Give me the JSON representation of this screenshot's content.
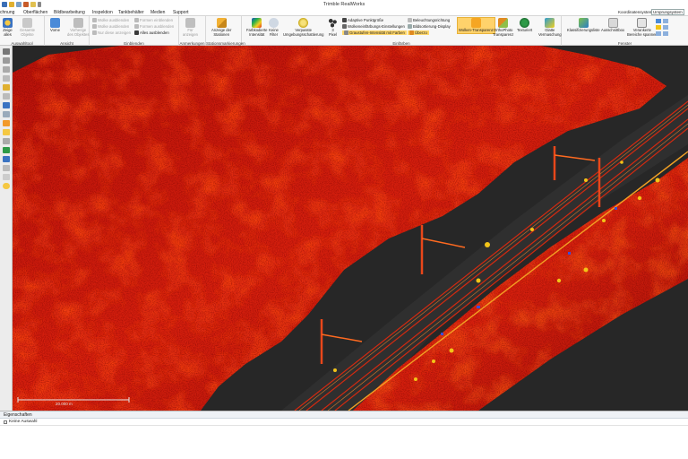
{
  "window": {
    "title": "Trimble RealWorks"
  },
  "menu": {
    "tabs": [
      "chnung",
      "Oberflächen",
      "Bildbearbeitung",
      "Inspektion",
      "Tankbehälter",
      "Medien",
      "Support"
    ],
    "coordinate_label": "Koordinatensystem",
    "coordinate_value": "Ursprungsystem"
  },
  "ribbon": {
    "groups": {
      "auswahl": {
        "label": "Auswahltool",
        "zeige": "Zeige\nalles",
        "gesamte": "Gesamte\nObjekte"
      },
      "ansicht": {
        "label": "Ansicht",
        "vorne": "Vorne",
        "vorherige": "Vorherige\ndes Objektes"
      },
      "einblenden": {
        "label": "Einblenden",
        "items": [
          "Wolke ausblenden",
          "Wolke ausblenden",
          "Nur diese anzeigen",
          "Formen einblenden",
          "Formen ausblenden",
          "Alles ausblenden"
        ]
      },
      "anmerkungen": {
        "label": "Anmerkungen",
        "button": "Für\nanzeigen"
      },
      "stationsmark": {
        "label": "Stationsmarkierungen",
        "button": "Anzeige der\nStationen"
      },
      "einfaerben": {
        "label": "Einfärben",
        "farbkodierte": "Farbkodierte\nIntensität",
        "keine": "Keine\nFilter",
        "verpasste": "Verpasste\nUmgebungsschattierung",
        "drei": "3\nPixel",
        "adaptive": "Adaptive Punktgröße",
        "wolken": "Wolkeneinfärbungs-Einstellungen",
        "graustufen": "Graustufen-Intensität mit Farben",
        "beleuchtung": "Beleuchtungsrichtung",
        "bildsortier": "Bildsortierung-Display",
        "ueberzo": "Überzo",
        "wolken_transparenz": "Wolken-Transparenz",
        "ortho": "OrthoPhoto\nTransparenz",
        "texturiert": "Texturiert",
        "glatte": "Glatte\nVermaschung"
      },
      "fenster": {
        "label": "Fenster",
        "klassifizierungs": "Klassifizierungsliste",
        "ausschnitt": "Ausschnittbox",
        "verankerte": "Verankerte\nBereiche spannen"
      }
    }
  },
  "viewport": {
    "scale_label": "20.000 m"
  },
  "properties": {
    "title": "Eigenschaften",
    "row": "Keine Auswahl"
  },
  "colors": {
    "ribbon_bg": "#f7f7f7",
    "highlight": "#ffd26b",
    "cloud_red": "#c2150d",
    "cloud_orange": "#e85a10",
    "cloud_yellow": "#f2c418"
  }
}
